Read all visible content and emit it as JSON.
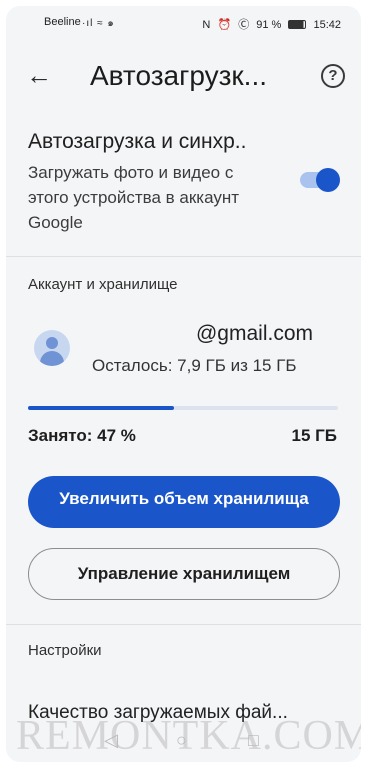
{
  "status_bar": {
    "carrier": "Beeline",
    "signal": "·ıl ≈ ๑",
    "right": [
      "N",
      "⏰",
      "Ⓒ",
      "91 %",
      "15:42"
    ]
  },
  "header": {
    "back_icon": "←",
    "title": "Автозагрузк...",
    "help_icon": "?"
  },
  "backup": {
    "title": "Автозагрузка и синхр..",
    "description": "Загружать фото и видео с этого устройства в аккаунт Google",
    "enabled": true
  },
  "account_section": {
    "heading": "Аккаунт и хранилище",
    "email": "@gmail.com",
    "remaining": "Осталось: 7,9 ГБ из 15 ГБ",
    "used_fraction": 0.47,
    "used_label": "Занято: 47 %",
    "total_label": "15 ГБ"
  },
  "buttons": {
    "increase_storage": "Увеличить объем хранилища",
    "manage_storage": "Управление хранилищем"
  },
  "settings_section": {
    "heading": "Настройки",
    "upload_quality": "Качество загружаемых фай..."
  },
  "navbar": {
    "back": "◁",
    "home": "○",
    "recent": "□"
  },
  "watermark": "REMONTKA.COM",
  "colors": {
    "accent": "#1a56c9",
    "background": "#f4f5f7"
  }
}
